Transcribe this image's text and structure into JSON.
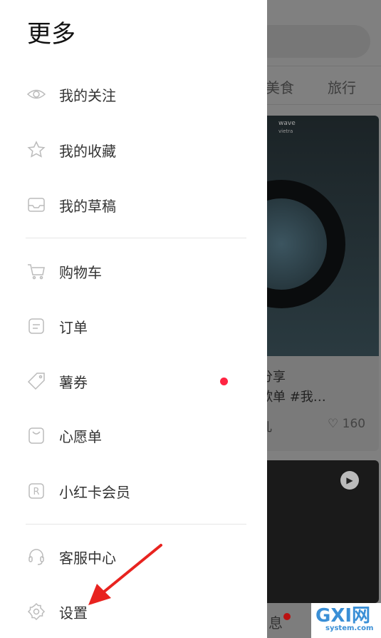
{
  "drawer": {
    "title": "更多",
    "items": [
      {
        "label": "我的关注",
        "icon": "eye-icon"
      },
      {
        "label": "我的收藏",
        "icon": "star-icon"
      },
      {
        "label": "我的草稿",
        "icon": "inbox-icon"
      },
      {
        "label": "购物车",
        "icon": "cart-icon"
      },
      {
        "label": "订单",
        "icon": "order-icon"
      },
      {
        "label": "薯券",
        "icon": "coupon-tag-icon",
        "badge": true
      },
      {
        "label": "心愿单",
        "icon": "bag-icon"
      },
      {
        "label": "小红卡会员",
        "icon": "r-card-icon"
      },
      {
        "label": "客服中心",
        "icon": "headset-icon"
      },
      {
        "label": "设置",
        "icon": "gear-icon"
      }
    ]
  },
  "background": {
    "tabs": [
      "美食",
      "旅行"
    ],
    "card1": {
      "brand": "wave",
      "sub": "vietra",
      "title1": "分享",
      "title2": "歌单 #我…",
      "author": "儿",
      "likes": "160"
    },
    "nav_label": "息"
  },
  "watermark": {
    "main": "GXI网",
    "sub": "system.com"
  },
  "colors": {
    "badge": "#ff2442",
    "annotation_arrow": "#e8231f"
  }
}
